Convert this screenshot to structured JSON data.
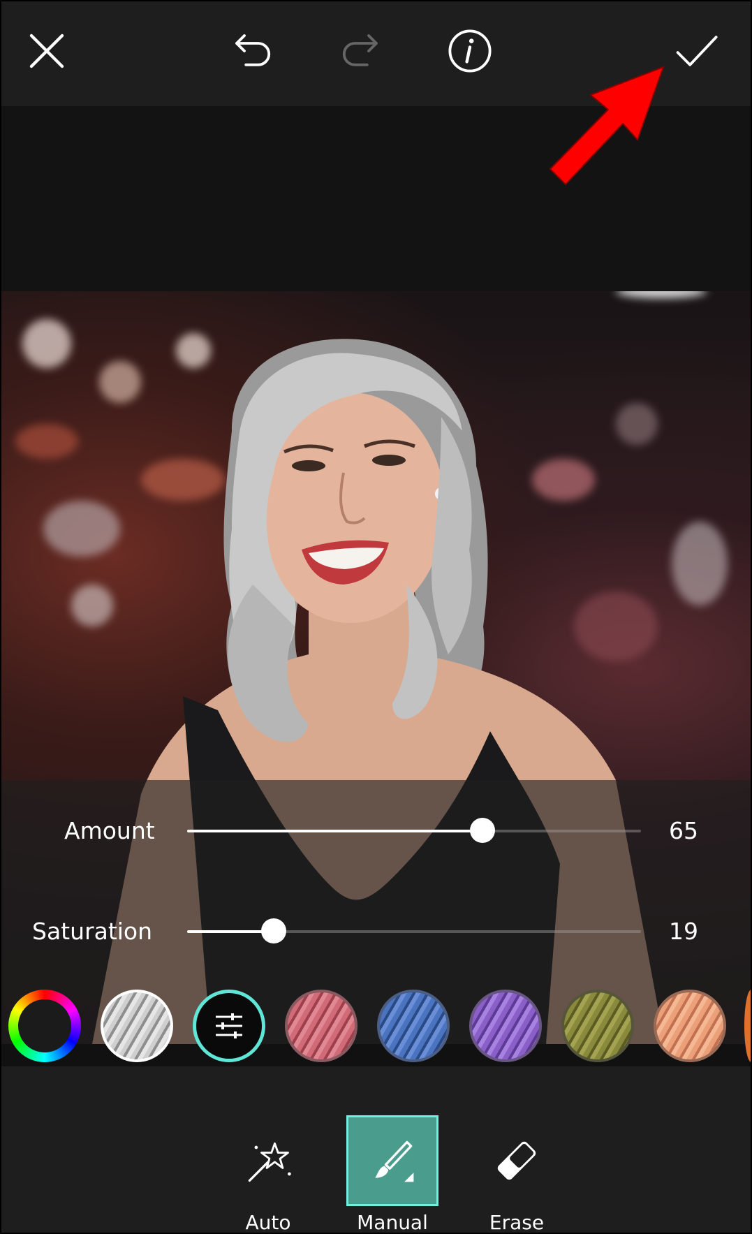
{
  "toolbar": {
    "close": "close-icon",
    "undo": "undo-icon",
    "redo": "redo-icon",
    "info": "info-icon",
    "apply": "checkmark-icon"
  },
  "sliders": [
    {
      "label": "Amount",
      "value": "65",
      "fraction": 0.65
    },
    {
      "label": "Saturation",
      "value": "19",
      "fraction": 0.19
    }
  ],
  "swatches": [
    {
      "name": "custom-color-wheel"
    },
    {
      "name": "silver",
      "color": "#b8b8b8"
    },
    {
      "name": "adjust",
      "selected": true
    },
    {
      "name": "rose",
      "color": "#c4606c"
    },
    {
      "name": "blue",
      "color": "#3f63a6"
    },
    {
      "name": "purple",
      "color": "#7f55b8"
    },
    {
      "name": "olive",
      "color": "#7a7a36"
    },
    {
      "name": "peach",
      "color": "#e2956e"
    }
  ],
  "tools": [
    {
      "label": "Auto",
      "icon": "magic-wand-icon"
    },
    {
      "label": "Manual",
      "icon": "brush-icon",
      "active": true
    },
    {
      "label": "Erase",
      "icon": "eraser-icon"
    }
  ],
  "colors": {
    "accent": "#5fe6d6",
    "active_tab": "#4a9c8c",
    "annotation_arrow": "#ff0000"
  }
}
